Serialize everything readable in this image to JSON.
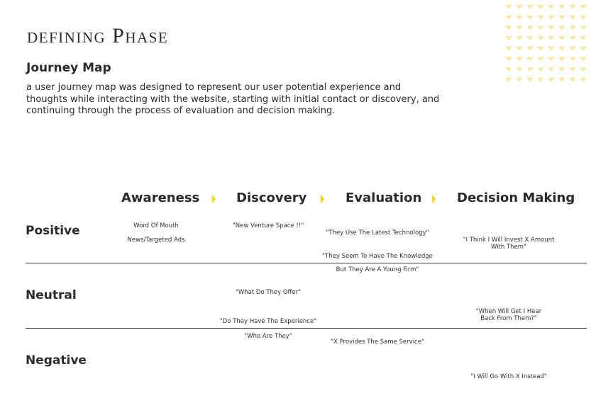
{
  "header": {
    "phase_title": "defining Phase",
    "section_heading": "Journey Map",
    "description": "a user journey map was designed to represent our user potential experience and thoughts while interacting with the website, starting with initial contact or discovery, and continuing through the process of evaluation and decision making."
  },
  "stages": [
    "Awareness",
    "Discovery",
    "Evaluation",
    "Decision Making"
  ],
  "rows": [
    "Positive",
    "Neutral",
    "Negative"
  ],
  "notes": {
    "awareness_1": "Word Of Mouth",
    "awareness_2": "News/Targeted Ads",
    "discovery_1": "\"New Venture Space !!\"",
    "discovery_2": "\"What Do They Offer\"",
    "discovery_3": "\"Do They Have The Experience\"",
    "discovery_4": "\"Who Are They\"",
    "evaluation_1": "\"They Use The Latest Technology\"",
    "evaluation_2": "\"They Seem To Have The Knowledge",
    "evaluation_3": "But They Are A Young Firm\"",
    "evaluation_4": "\"X Provides The Same Service\"",
    "decision_1a": "\"I Think I Will Invest X Amount",
    "decision_1b": "With Them\"",
    "decision_2a": "\"When Will Get I Hear",
    "decision_2b": "Back From Them?\"",
    "decision_3": "\"I Will Go With X Instead\""
  },
  "colors": {
    "accent": "#f0d400",
    "decoration": "#f5e9a8",
    "text": "#2b2b2b"
  }
}
